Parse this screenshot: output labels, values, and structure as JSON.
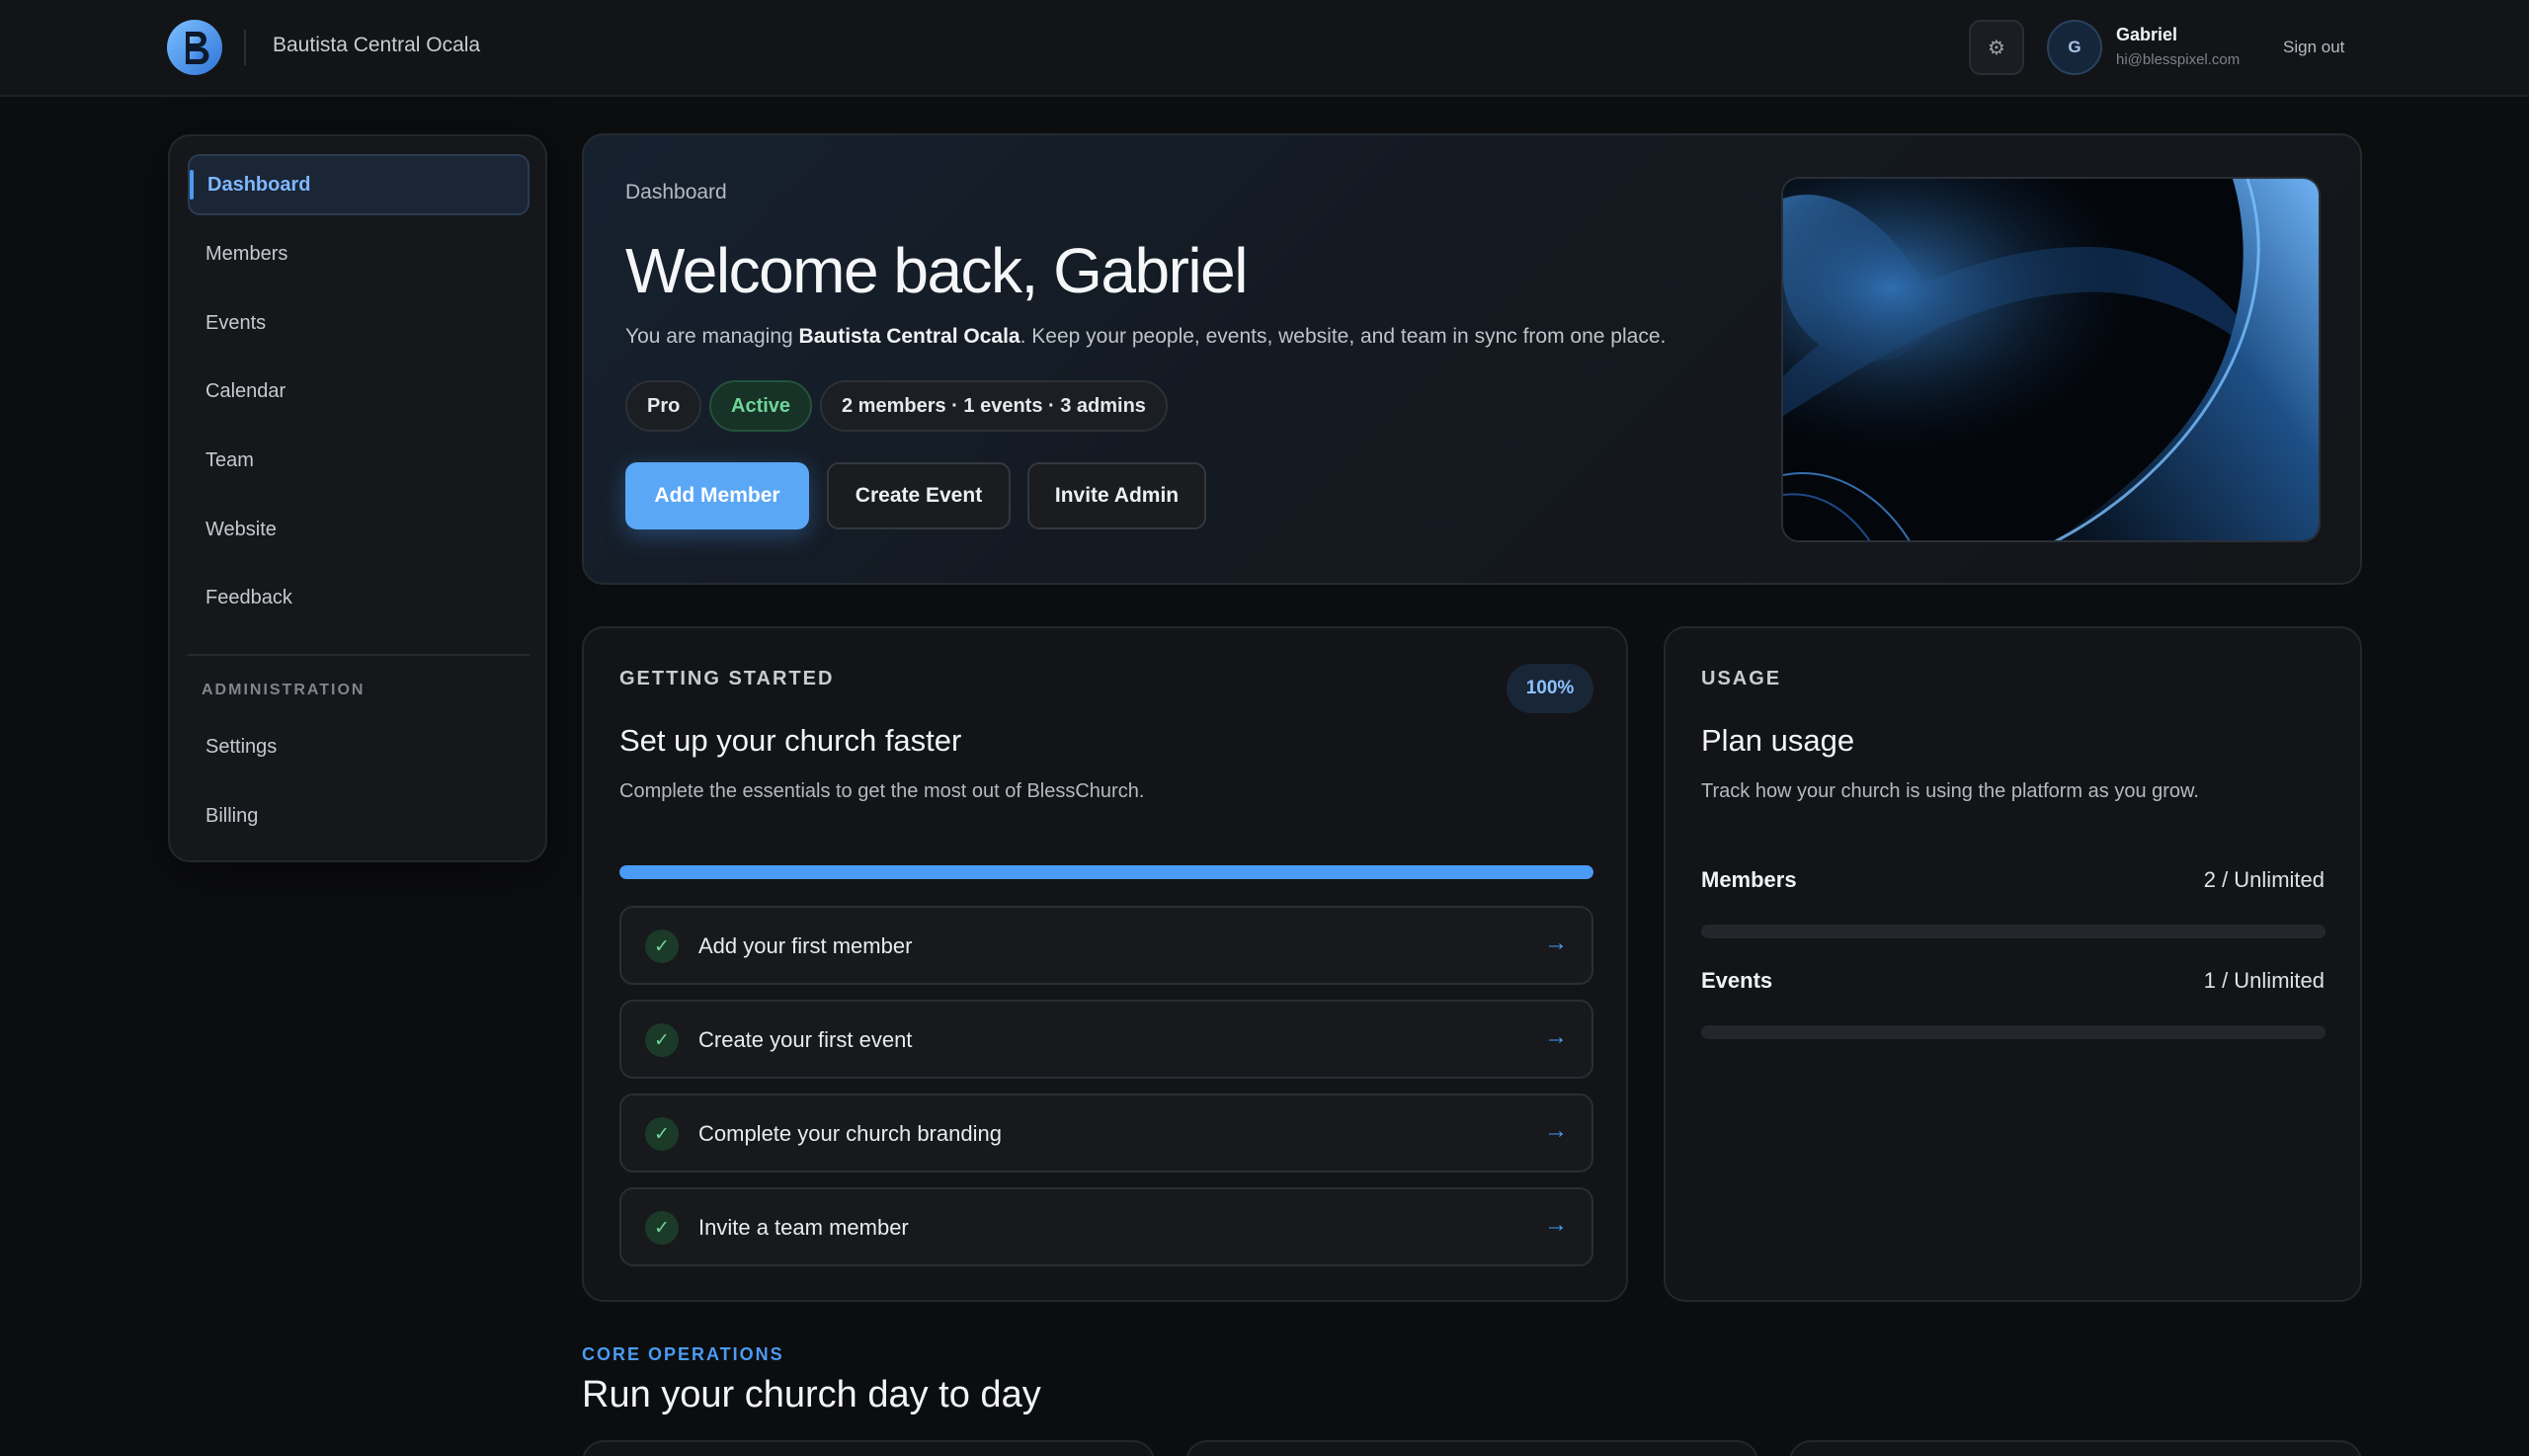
{
  "header": {
    "church_name": "Bautista Central Ocala",
    "settings_icon": "gear-icon",
    "user": {
      "initial": "G",
      "name": "Gabriel",
      "email": "hi@blesspixel.com"
    },
    "sign_out_label": "Sign out"
  },
  "sidebar": {
    "items": [
      {
        "label": "Dashboard",
        "active": true
      },
      {
        "label": "Members"
      },
      {
        "label": "Events"
      },
      {
        "label": "Calendar"
      },
      {
        "label": "Team"
      },
      {
        "label": "Website"
      },
      {
        "label": "Feedback"
      }
    ],
    "section_label": "ADMINISTRATION",
    "admin_items": [
      {
        "label": "Settings"
      },
      {
        "label": "Billing"
      }
    ]
  },
  "hero": {
    "breadcrumb": "Dashboard",
    "title": "Welcome back, Gabriel",
    "subtitle_prefix": "You are managing ",
    "subtitle_church": "Bautista Central Ocala",
    "subtitle_suffix": ". Keep your people, events, website, and team in sync from one place.",
    "pills": {
      "plan": "Pro",
      "status": "Active",
      "stats": "2 members · 1 events · 3 admins"
    },
    "buttons": {
      "add_member": "Add Member",
      "create_event": "Create Event",
      "invite_admin": "Invite Admin"
    }
  },
  "getting_started": {
    "eyebrow": "GETTING STARTED",
    "badge": "100%",
    "progress": 1.0,
    "title": "Set up your church faster",
    "description": "Complete the essentials to get the most out of BlessChurch.",
    "tasks": [
      {
        "label": "Add your first member",
        "done": true
      },
      {
        "label": "Create your first event",
        "done": true
      },
      {
        "label": "Complete your church branding",
        "done": true
      },
      {
        "label": "Invite a team member",
        "done": true
      }
    ]
  },
  "usage": {
    "eyebrow": "USAGE",
    "title": "Plan usage",
    "description": "Track how your church is using the platform as you grow.",
    "rows": [
      {
        "label": "Members",
        "value": "2 / Unlimited",
        "fill": 0.0
      },
      {
        "label": "Events",
        "value": "1 / Unlimited",
        "fill": 0.0
      }
    ]
  },
  "core_operations": {
    "eyebrow": "CORE OPERATIONS",
    "title": "Run your church day to day"
  },
  "colors": {
    "accent": "#4a9bf5",
    "success": "#6fd49a",
    "background": "#0c0d0f"
  }
}
